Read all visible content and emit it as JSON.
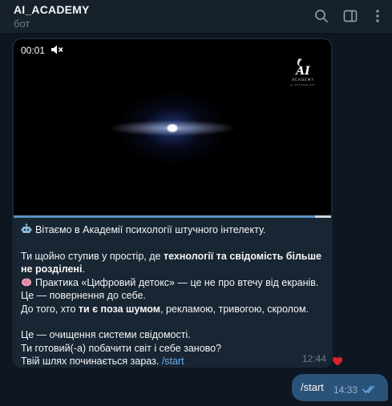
{
  "header": {
    "title": "AI_ACADEMY",
    "subtitle": "бот",
    "icons": [
      "search-icon",
      "sidebar-toggle-icon",
      "more-vertical-icon"
    ]
  },
  "incoming_message": {
    "video": {
      "timestamp": "00:01",
      "muted": true,
      "progress_fraction": 0.95,
      "logo_lines": [
        "ACADEMY",
        "AI PSYCHOLOGY"
      ]
    },
    "paragraph1": "Вітаємо в Академії психології штучного інтелекту.",
    "p2_a": "Ти щойно ступив у простір, де ",
    "p2_b": "технології та свідомість більше не розділені",
    "p2_c": ".",
    "p3_a": "Практика «Цифровий детокс» — це не про втечу від екранів.",
    "p3_b": "Це — повернення до себе.",
    "p4_a": "До того, хто ",
    "p4_b": "ти є поза шумом",
    "p4_c": ", рекламою, тривогою, скролом.",
    "p5_a": "Це — очищення системи свідомості.",
    "p5_b": "Ти готовий(-а) побачити світ і себе заново?",
    "p5_c": "Твій шлях починається зараз. ",
    "command": "/start",
    "time": "12:44",
    "reaction": "heart-icon"
  },
  "outgoing_message": {
    "text": "/start",
    "time": "14:33",
    "status": "double-check-icon"
  },
  "colors": {
    "background": "#0e1621",
    "header": "#17212b",
    "incoming_bubble": "#182533",
    "outgoing_bubble": "#2b5278",
    "link": "#6ab3f3",
    "muted_text": "#6d7f8f"
  }
}
